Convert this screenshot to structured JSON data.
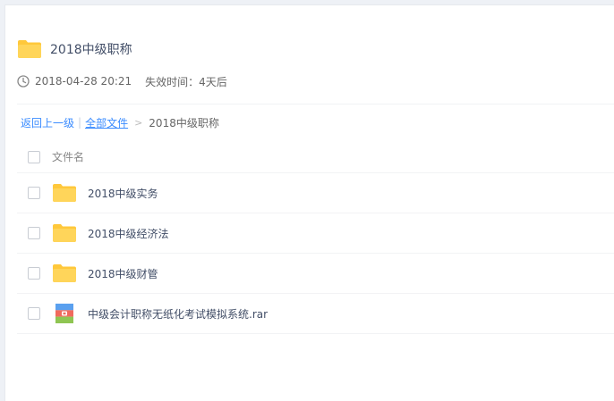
{
  "share": {
    "title": "2018中级职称",
    "date": "2018-04-28 20:21",
    "expire": "失效时间：4天后"
  },
  "breadcrumb": {
    "back": "返回上一级",
    "separator": "|",
    "all_files": "全部文件",
    "arrow": ">",
    "current": "2018中级职称"
  },
  "list": {
    "column_title": "文件名",
    "items": [
      {
        "name": "2018中级实务",
        "icon": "folder-icon"
      },
      {
        "name": "2018中级经济法",
        "icon": "folder-icon"
      },
      {
        "name": "2018中级财管",
        "icon": "folder-icon"
      },
      {
        "name": "中级会计职称无纸化考试模拟系统.rar",
        "icon": "rar-archive-icon"
      }
    ]
  },
  "colors": {
    "folder": "#ffcd45",
    "link": "#3b8cff",
    "title": "#424e67"
  }
}
